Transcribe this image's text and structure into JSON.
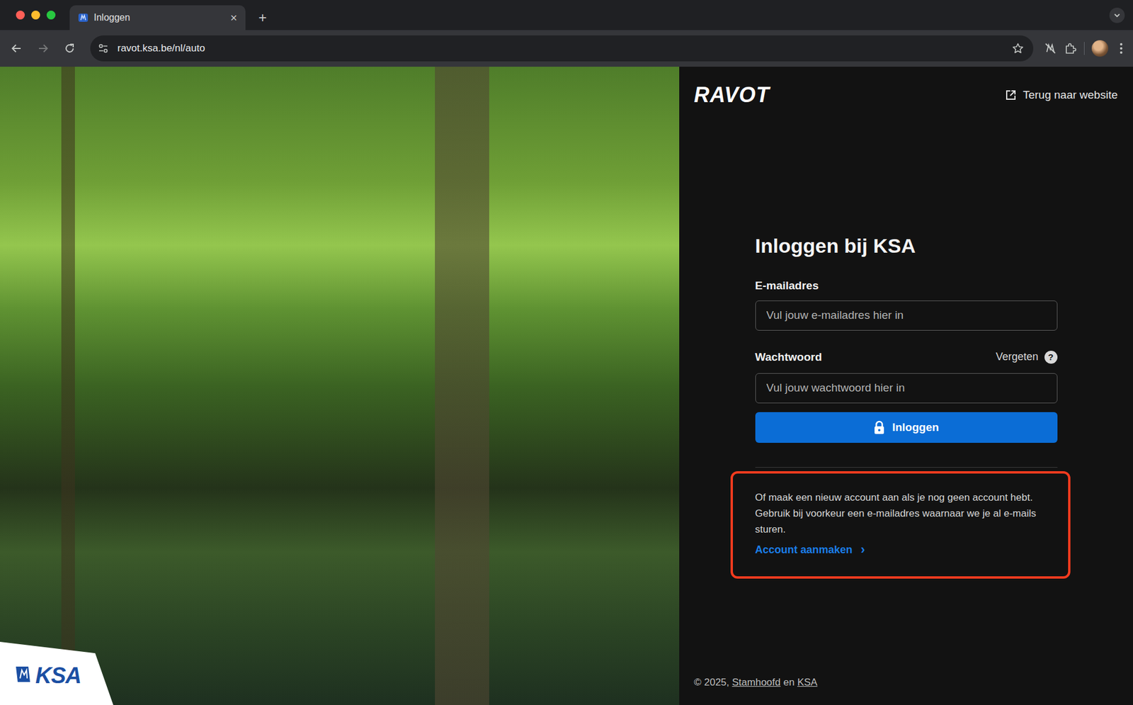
{
  "window": {
    "tab": {
      "label": "Inloggen",
      "selected": true,
      "close": "×"
    },
    "new_tab": "+",
    "url": "ravot.ksa.be/nl/auto",
    "nav": {
      "back_disabled": false,
      "forward_disabled": true
    }
  },
  "photo_logo": "KSA",
  "header": {
    "logo": "RAVOT",
    "website_link": "Terug naar website"
  },
  "login": {
    "title": "Inloggen bij KSA",
    "email_label": "E-mailadres",
    "email_placeholder": "Vul jouw e-mailadres hier in",
    "password_label": "Wachtwoord",
    "forgot": "Vergeten",
    "forgot_icon": "?",
    "password_placeholder": "Vul jouw wachtwoord hier in",
    "submit": "Inloggen"
  },
  "signup": {
    "text": "Of maak een nieuw account aan als je nog geen account hebt. Gebruik bij voorkeur een e-mailadres waarnaar we je al e-mails sturen.",
    "link": "Account aanmaken",
    "link_arrow": "›",
    "highlighted": true
  },
  "footer": {
    "copyright": "© 2025,",
    "links": [
      {
        "label": "Stamhoofd"
      },
      {
        "label": "KSA"
      }
    ],
    "joiner": "en"
  }
}
